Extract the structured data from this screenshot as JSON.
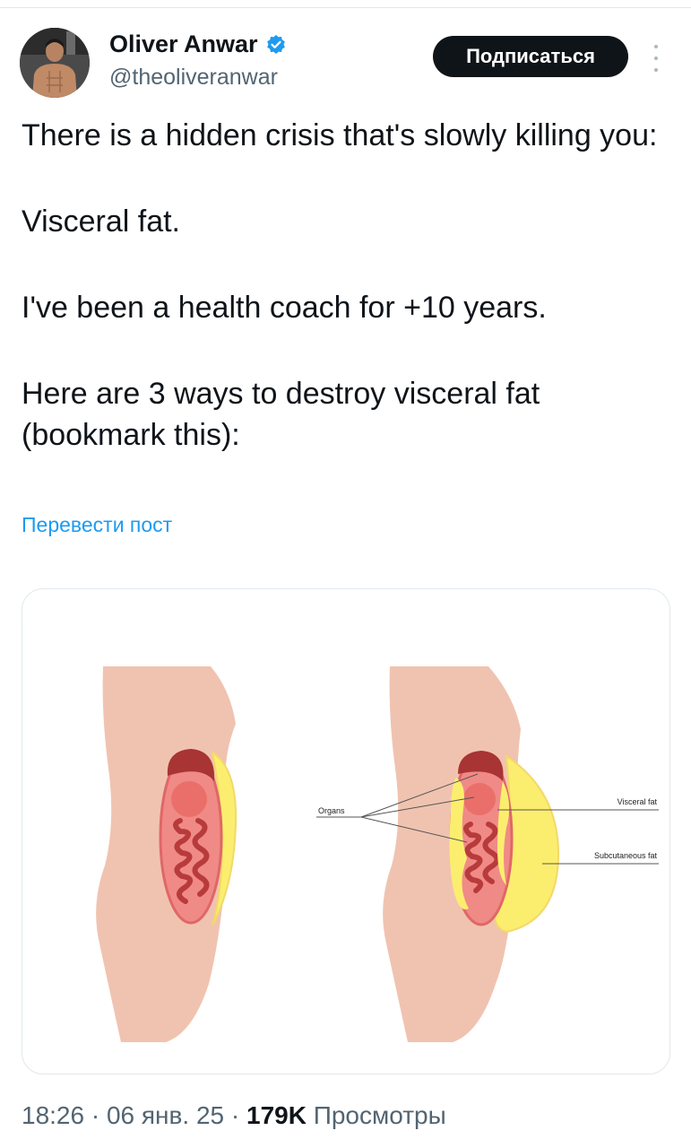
{
  "author": {
    "display_name": "Oliver Anwar",
    "handle": "@theoliveranwar",
    "verified": true,
    "avatar_icon": "profile-photo-icon"
  },
  "actions": {
    "subscribe_label": "Подписаться",
    "more_icon": "more-vertical-icon"
  },
  "tweet": {
    "paragraphs": [
      "There is a hidden crisis that's slowly killing you:",
      "Visceral fat.",
      "I've been a health coach for +10 years.",
      "Here are 3 ways to destroy visceral fat (bookmark this):"
    ],
    "translate_label": "Перевести пост"
  },
  "media": {
    "labels": {
      "organs": "Organs",
      "visceral_fat": "Visceral fat",
      "subcutaneous_fat": "Subcutaneous fat"
    }
  },
  "meta": {
    "time": "18:26",
    "date": "06 янв. 25",
    "separator": "·",
    "views_count": "179K",
    "views_label": "Просмотры"
  },
  "colors": {
    "skin": "#f0c3b0",
    "organ_red": "#e65c5c",
    "organ_pink": "#f08a86",
    "organ_dark": "#a83434",
    "fat_yellow": "#fbee6e",
    "badge_blue": "#1d9bf0"
  }
}
